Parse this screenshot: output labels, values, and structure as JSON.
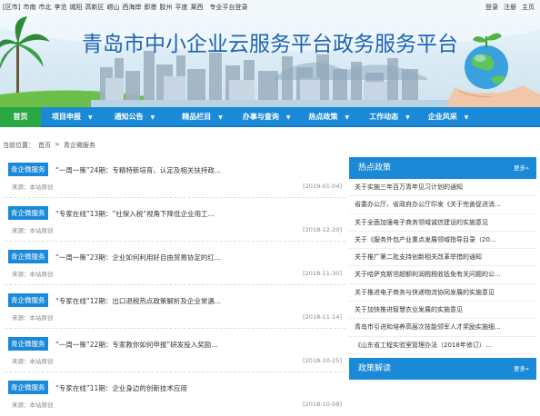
{
  "topbar": {
    "regions": [
      "[区市]",
      "市南",
      "市北",
      "李沧",
      "城阳",
      "高新区",
      "崂山",
      "西海岸",
      "即墨",
      "胶州",
      "平度",
      "莱西",
      "专业平台登录"
    ],
    "links": [
      "登录",
      "注册",
      "主页"
    ]
  },
  "banner": {
    "title": "青岛市中小企业云服务平台政务服务平台"
  },
  "nav": {
    "items": [
      "首页",
      "项目申报",
      "通知公告",
      "精品栏目",
      "办事与查询",
      "热点政策",
      "工作动态",
      "企业风采"
    ]
  },
  "breadcrumb": {
    "label": "当前位置：",
    "home": "首页",
    "sep": ">",
    "current": "青企微服务"
  },
  "news": [
    {
      "tag": "青企微服务",
      "title": "“一周一策”24期：专精特新培育、认定及相关扶持政...",
      "source": "来源：本站原创",
      "date": "[2019-01-04]"
    },
    {
      "tag": "青企微服务",
      "title": "“专家在线”13期：“社保入税”视角下降低企业用工...",
      "source": "来源：本站原创",
      "date": "[2018-12-20]"
    },
    {
      "tag": "青企微服务",
      "title": "“一周一策”23期：企业如何利用好自由贸易协定的红...",
      "source": "来源：本站原创",
      "date": "[2018-11-30]"
    },
    {
      "tag": "青企微服务",
      "title": "“专家在线”12期：出口退税热点政策解析及企业常遇...",
      "source": "来源：本站原创",
      "date": "[2018-11-14]"
    },
    {
      "tag": "青企微服务",
      "title": "“一周一策”22期：专家教你如何申报“研发投入奖励...",
      "source": "来源：本站原创",
      "date": "[2018-10-25]"
    },
    {
      "tag": "青企微服务",
      "title": "“专家在线”11期：企业身边的创新技术应用",
      "source": "来源：本站原创",
      "date": "[2018-10-08]"
    }
  ],
  "sidebar": {
    "hot_title": "热点政策",
    "more": "更多»",
    "policies": [
      "关于实施三年百万青年见习计划的通知",
      "省委办公厅、省政府办公厅印发《关于完善促进消...",
      "关于全面加强电子商务领域诚信建设的实施意见",
      "关于《服务外包产业重点发展领域指导目录（20...",
      "关于推广第二批支持创新相关改革举措的通知",
      "关于哈萨克斯坦超额利润税税收抵免有关问题的公...",
      "关于推进电子商务与快递物流协同发展的实施意见",
      "关于加快推进智慧农业发展的实施意见",
      "青岛市引进和培养高层次技能领军人才奖励实施细...",
      "《山东省工程实验室管理办法（2018年修订）..."
    ],
    "read_title": "政策解读"
  },
  "colors": {
    "nav_blue": "#1a8ad8",
    "home_green": "#2aa844",
    "title_blue": "#1d63b5"
  }
}
